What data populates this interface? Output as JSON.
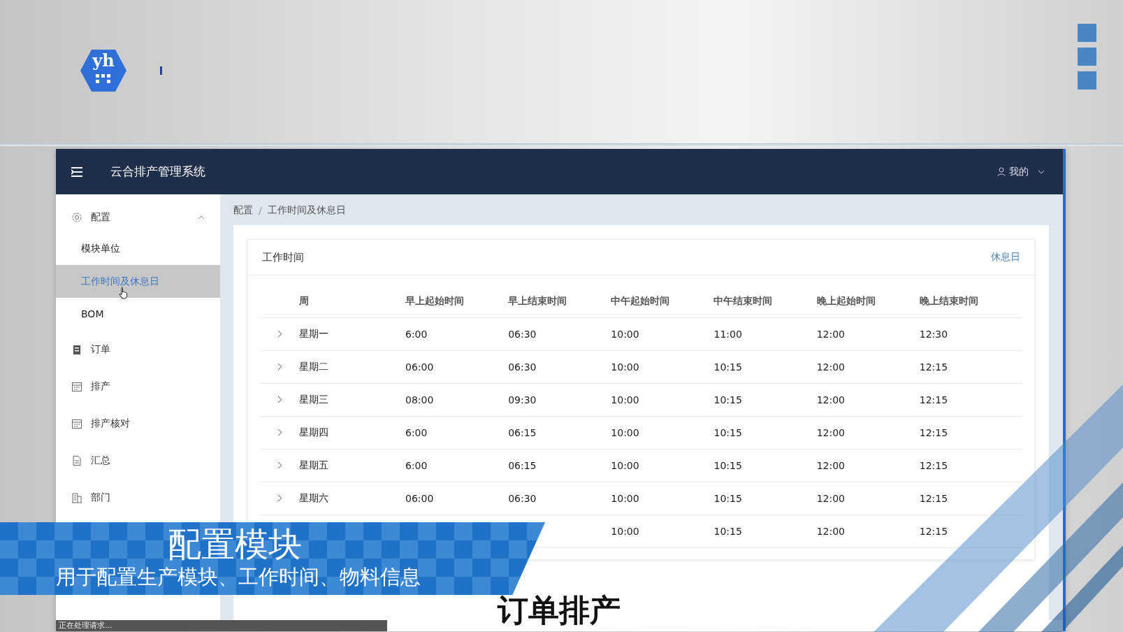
{
  "logo": {
    "text": "yh"
  },
  "app": {
    "title": "云合排产管理系统",
    "user": "我的"
  },
  "sidebar": [
    {
      "label": "配置",
      "kind": "gear",
      "expanded": true,
      "children": [
        {
          "label": "模块单位",
          "selected": false
        },
        {
          "label": "工作时间及休息日",
          "selected": true
        },
        {
          "label": "BOM",
          "selected": false
        }
      ]
    },
    {
      "label": "订单",
      "kind": "clipboard"
    },
    {
      "label": "排产",
      "kind": "calendar"
    },
    {
      "label": "排产核对",
      "kind": "calendar"
    },
    {
      "label": "汇总",
      "kind": "document"
    },
    {
      "label": "部门",
      "kind": "building"
    }
  ],
  "breadcrumb": {
    "items": [
      "配置",
      "工作时间及休息日"
    ],
    "separator": "/"
  },
  "card": {
    "title": "工作时间",
    "action": "休息日"
  },
  "table": {
    "columns": [
      "周",
      "早上起始时间",
      "早上结束时间",
      "中午起始时间",
      "中午结束时间",
      "晚上起始时间",
      "晚上结束时间"
    ],
    "rows": [
      {
        "expanded": false,
        "cells": [
          "星期一",
          "6:00",
          "06:30",
          "10:00",
          "11:00",
          "12:00",
          "12:30"
        ]
      },
      {
        "expanded": false,
        "cells": [
          "星期二",
          "06:00",
          "06:30",
          "10:00",
          "10:15",
          "12:00",
          "12:15"
        ]
      },
      {
        "expanded": false,
        "cells": [
          "星期三",
          "08:00",
          "09:30",
          "10:00",
          "10:15",
          "12:00",
          "12:15"
        ]
      },
      {
        "expanded": false,
        "cells": [
          "星期四",
          "6:00",
          "06:15",
          "10:00",
          "10:15",
          "12:00",
          "12:15"
        ]
      },
      {
        "expanded": false,
        "cells": [
          "星期五",
          "6:00",
          "06:15",
          "10:00",
          "10:15",
          "12:00",
          "12:15"
        ]
      },
      {
        "expanded": false,
        "cells": [
          "星期六",
          "06:00",
          "06:30",
          "10:00",
          "10:15",
          "12:00",
          "12:15"
        ]
      },
      {
        "cells": [
          null,
          null,
          null,
          "10:00",
          "10:15",
          "12:00",
          "12:15"
        ]
      }
    ]
  },
  "status_text": "正在处理请求...",
  "banner": {
    "title": "配置模块",
    "subtitle": "用于配置生产模块、工作时间、物料信息"
  },
  "caption": "订单排产"
}
